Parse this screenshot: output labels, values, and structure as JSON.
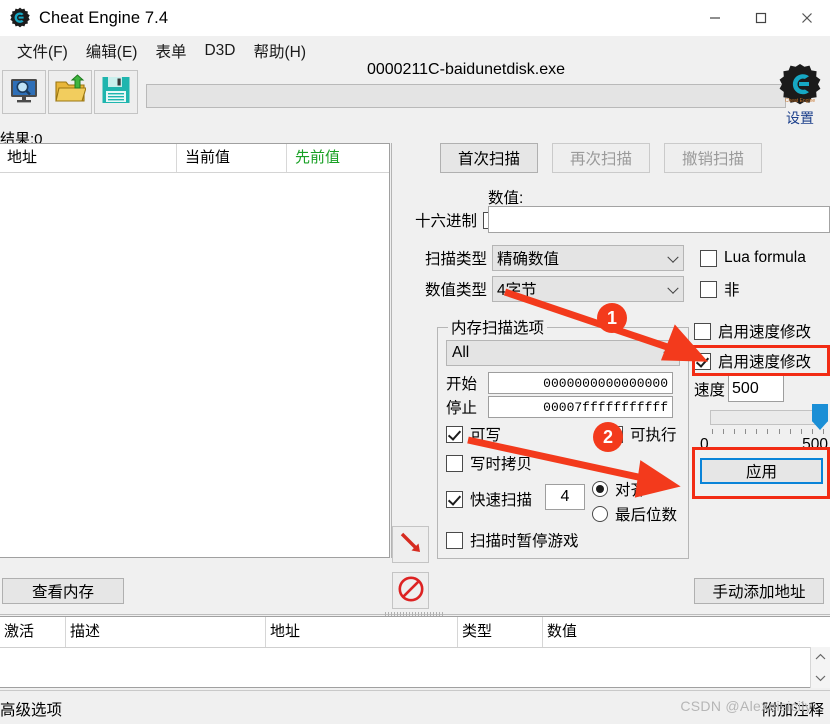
{
  "window": {
    "title": "Cheat Engine 7.4",
    "logo_icon": "cheat-engine-logo-icon",
    "minimize_icon": "minimize-icon",
    "maximize_icon": "maximize-icon",
    "close_icon": "close-icon"
  },
  "menubar": {
    "items": [
      {
        "label": "文件(F)",
        "name": "menu-file"
      },
      {
        "label": "编辑(E)",
        "name": "menu-edit"
      },
      {
        "label": "表单",
        "name": "menu-table"
      },
      {
        "label": "D3D",
        "name": "menu-d3d"
      },
      {
        "label": "帮助(H)",
        "name": "menu-help"
      }
    ]
  },
  "toolbar": {
    "process_button_icon": "monitor-magnifier-icon",
    "open_button_icon": "open-folder-icon",
    "save_button_icon": "floppy-save-icon",
    "process_title": "0000211C-baidunetdisk.exe",
    "settings_label": "设置",
    "settings_icon": "cheat-engine-gear-icon"
  },
  "results": {
    "count_label": "结果:0",
    "columns": [
      "地址",
      "当前值",
      "先前值"
    ],
    "previous_value_color": "#18a024",
    "rows": []
  },
  "scan": {
    "first_scan_label": "首次扫描",
    "next_scan_label": "再次扫描",
    "undo_scan_label": "撤销扫描",
    "value_label": "数值:",
    "value_input": "",
    "hex_label": "十六进制",
    "hex_checked": false,
    "scan_type_label": "扫描类型",
    "scan_type_value": "精确数值",
    "value_type_label": "数值类型",
    "value_type_value": "4字节",
    "lua_formula_label": "Lua formula",
    "lua_formula_checked": false,
    "not_label": "非",
    "not_checked": false
  },
  "memory_options": {
    "group_title": "内存扫描选项",
    "region_value": "All",
    "start_label": "开始",
    "start_value": "0000000000000000",
    "stop_label": "停止",
    "stop_value": "00007fffffffffff",
    "writable_label": "可写",
    "writable_checked": true,
    "executable_label": "可执行",
    "executable_checked": false,
    "copyonwrite_label": "写时拷贝",
    "copyonwrite_checked": false,
    "fastscan_label": "快速扫描",
    "fastscan_checked": true,
    "fastscan_value": "4",
    "alignment_label": "对齐",
    "alignment_selected": true,
    "lastdigits_label": "最后位数",
    "lastdigits_selected": false,
    "pause_label": "扫描时暂停游戏",
    "pause_checked": false
  },
  "speedhack": {
    "enable_label_top": "启用速度修改",
    "enable_checked_top": false,
    "enable_label_bottom": "启用速度修改",
    "enable_checked_bottom": true,
    "speed_label": "速度",
    "speed_value": "500",
    "slider_min_label": "0",
    "slider_max_label": "500",
    "slider_value": 500,
    "apply_label": "应用",
    "accent_color": "#0a84d8"
  },
  "bottom": {
    "view_memory_label": "查看内存",
    "add_address_label": "手动添加地址",
    "red_arrow_icon": "red-arrow-icon",
    "no_entry_icon": "no-entry-icon"
  },
  "cheat_table": {
    "columns": [
      "激活",
      "描述",
      "地址",
      "类型",
      "数值"
    ],
    "rows": [],
    "scroll_up_icon": "chevron-up-icon",
    "scroll_down_icon": "chevron-down-icon"
  },
  "statusbar": {
    "advanced_label": "高级选项",
    "annotation_label": "附加注释"
  },
  "watermark": {
    "text": "CSDN @Alexeisicily"
  },
  "annotations": {
    "badge_1": "1",
    "badge_2": "2",
    "highlight_color": "#f22c14"
  }
}
